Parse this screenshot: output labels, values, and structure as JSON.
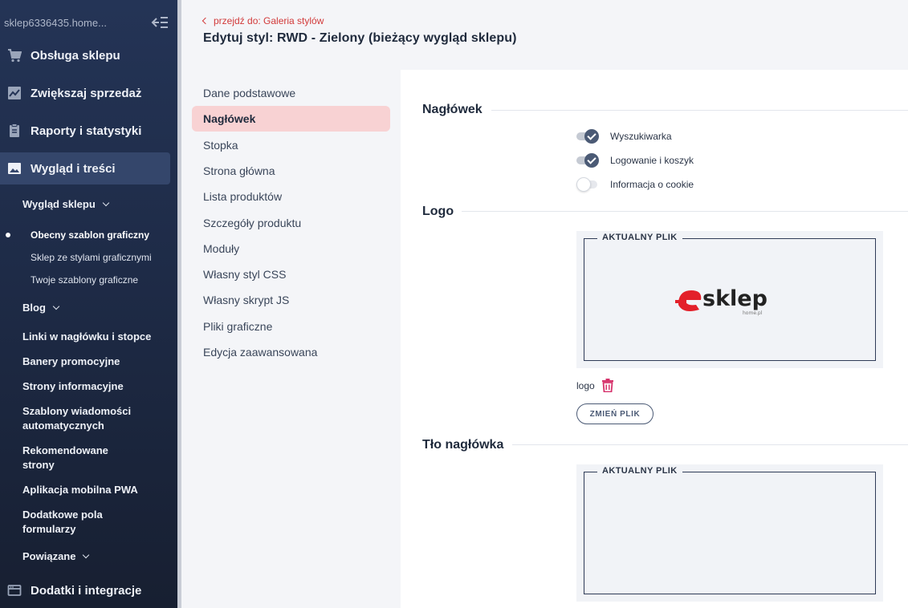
{
  "sidebar": {
    "shop_name": "sklep6336435.home...",
    "main_items": [
      {
        "label": "Obsługa sklepu"
      },
      {
        "label": "Zwiększaj sprzedaż"
      },
      {
        "label": "Raporty i statystyki"
      },
      {
        "label": "Wygląd i treści"
      },
      {
        "label": "Dodatki i integracje"
      }
    ],
    "sub_group_appearance": "Wygląd sklepu",
    "sub_appearance_items": [
      {
        "label": "Obecny szablon graficzny"
      },
      {
        "label": "Sklep ze stylami graficznymi"
      },
      {
        "label": "Twoje szablony graficzne"
      }
    ],
    "sub_items": [
      {
        "label": "Blog"
      },
      {
        "label": "Linki w nagłówku i stopce"
      },
      {
        "label": "Banery promocyjne"
      },
      {
        "label": "Strony informacyjne"
      },
      {
        "label": "Szablony wiadomości"
      },
      {
        "label": "automatycznych"
      },
      {
        "label": "Rekomendowane"
      },
      {
        "label": "strony"
      },
      {
        "label": "Aplikacja mobilna PWA"
      },
      {
        "label": "Dodatkowe pola"
      },
      {
        "label": "formularzy"
      },
      {
        "label": "Powiązane"
      }
    ]
  },
  "header": {
    "back_link": "przejdź do: Galeria stylów",
    "title": "Edytuj styl: RWD - Zielony (bieżący wygląd sklepu)"
  },
  "settings_nav": [
    {
      "label": "Dane podstawowe"
    },
    {
      "label": "Nagłówek"
    },
    {
      "label": "Stopka"
    },
    {
      "label": "Strona główna"
    },
    {
      "label": "Lista produktów"
    },
    {
      "label": "Szczegóły produktu"
    },
    {
      "label": "Moduły"
    },
    {
      "label": "Własny styl CSS"
    },
    {
      "label": "Własny skrypt JS"
    },
    {
      "label": "Pliki graficzne"
    },
    {
      "label": "Edycja zaawansowana"
    }
  ],
  "content": {
    "section_header": "Nagłówek",
    "toggles": [
      {
        "label": "Wyszukiwarka",
        "on": true
      },
      {
        "label": "Logowanie i koszyk",
        "on": true
      },
      {
        "label": "Informacja o cookie",
        "on": false
      }
    ],
    "section_logo": "Logo",
    "current_file_label": "AKTUALNY PLIK",
    "logo_text": "sklep",
    "logo_subtext": "home.pl",
    "file_name": "logo",
    "change_button": "ZMIEŃ PLIK",
    "section_header_bg": "Tło nagłówka",
    "current_file_label_2": "AKTUALNY PLIK"
  },
  "colors": {
    "accent_red": "#d23a3a",
    "active_nav_bg": "#f8d2d3",
    "sidebar_bg": "#243456",
    "toggle_on": "#4b5a75"
  }
}
